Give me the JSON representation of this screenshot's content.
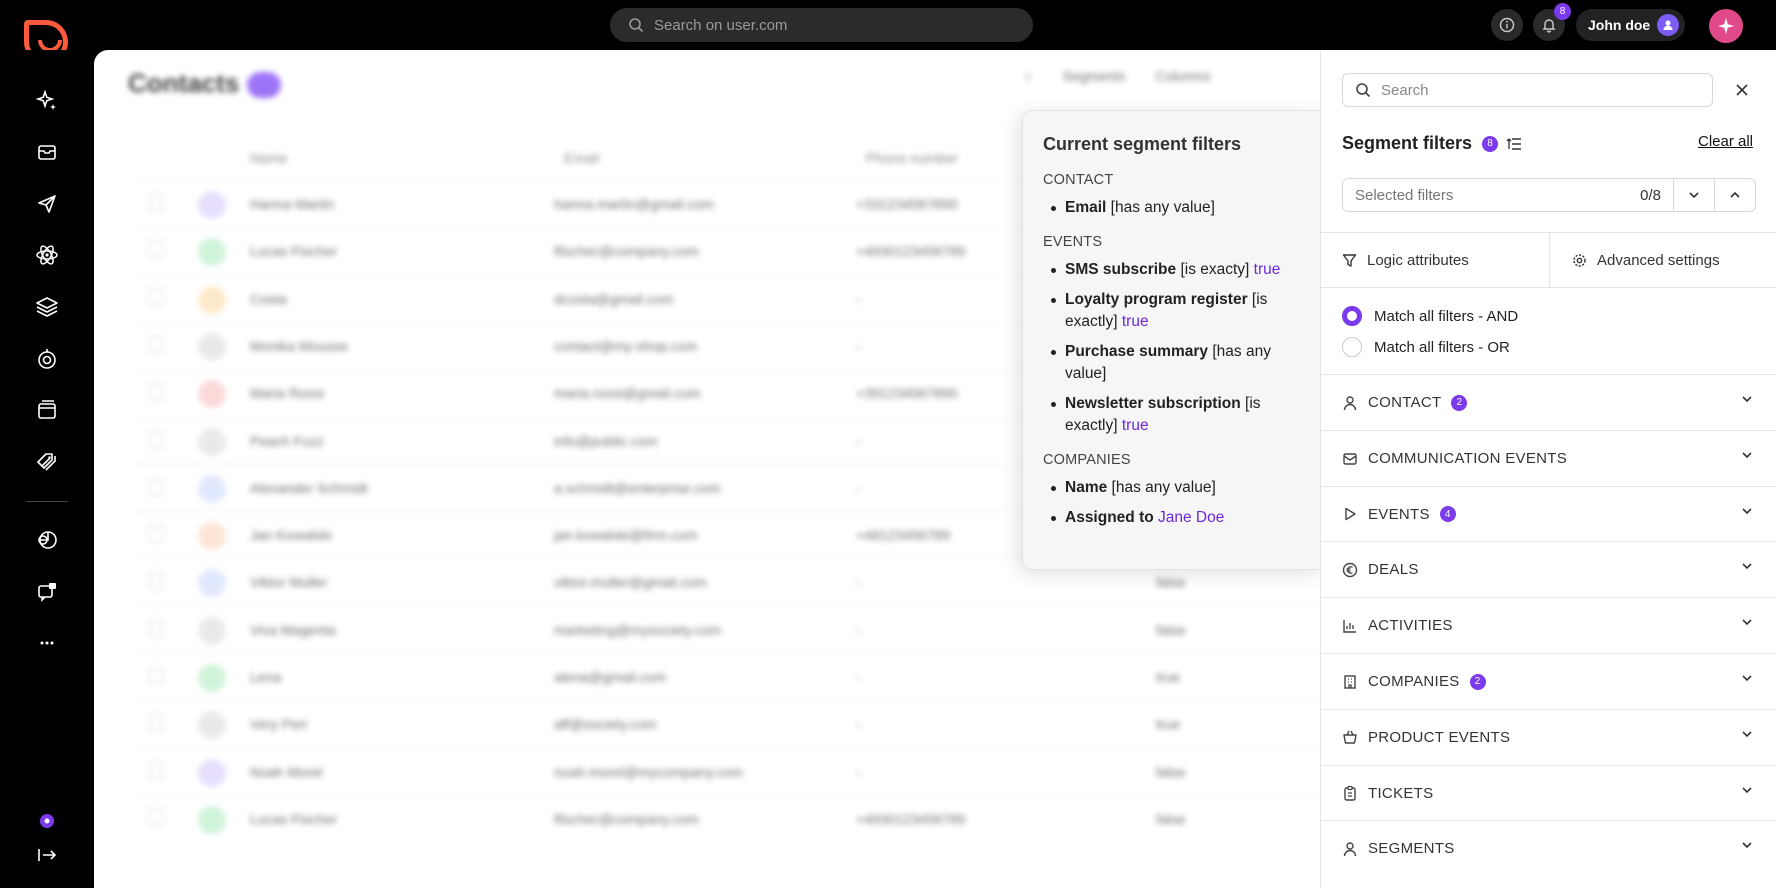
{
  "topbar": {
    "search_placeholder": "Search on user.com",
    "notification_count": "8",
    "user_name": "John doe"
  },
  "sidebar": {
    "icons": [
      "sparkles-icon",
      "inbox-icon",
      "send-icon",
      "atom-icon",
      "layers-icon",
      "analytics-icon",
      "browser-window-icon",
      "tags-icon",
      "pie-icon",
      "chat-icon",
      "more-icon"
    ]
  },
  "contacts": {
    "title": "Contacts",
    "toolbar": {
      "segments": "Segments",
      "columns": "Columns"
    },
    "columns": {
      "name": "Name",
      "email": "Email",
      "phone": "Phone number"
    },
    "rows": [
      {
        "initials": "HM",
        "name": "Hanna Martin",
        "email": "hanna.martin@gmail.com",
        "phone": "+331234567890",
        "bool": "",
        "color": "#e2d9fb"
      },
      {
        "initials": "LF",
        "name": "Lucas Fischer",
        "email": "lfischer@company.com",
        "phone": "+4930123456789",
        "bool": "",
        "color": "#c9f1d4"
      },
      {
        "initials": "C",
        "name": "Costa",
        "email": "dcosta@gmail.com",
        "phone": "-",
        "bool": "",
        "color": "#fde7c2"
      },
      {
        "initials": "",
        "name": "Monika Mousse",
        "email": "contact@my-shop.com",
        "phone": "-",
        "bool": "",
        "color": "#e6e6e6"
      },
      {
        "initials": "MR",
        "name": "Maria Rossi",
        "email": "maria.rossi@gmail.com",
        "phone": "+391234567890",
        "bool": "",
        "color": "#fbd3d3"
      },
      {
        "initials": "",
        "name": "Peach Fuzz",
        "email": "info@public.com",
        "phone": "-",
        "bool": "",
        "color": "#e6e6e6"
      },
      {
        "initials": "AS",
        "name": "Alexander Schmidt",
        "email": "a.schmidt@enterprise.com",
        "phone": "-",
        "bool": "",
        "color": "#dbe4fd"
      },
      {
        "initials": "JK",
        "name": "Jan Kowalski",
        "email": "jan.kowalski@firm.com",
        "phone": "+48123456789",
        "bool": "",
        "color": "#fde0cf"
      },
      {
        "initials": "VM",
        "name": "Viktor Muller",
        "email": "viktor.muller@gmail.com",
        "phone": "-",
        "bool": "false",
        "color": "#dbe4fd"
      },
      {
        "initials": "",
        "name": "Viva Magenta",
        "email": "marketing@mysociety.com",
        "phone": "-",
        "bool": "false",
        "color": "#e6e6e6"
      },
      {
        "initials": "L",
        "name": "Lena",
        "email": "alena@gmail.com",
        "phone": "-",
        "bool": "true",
        "color": "#c9f1d4"
      },
      {
        "initials": "",
        "name": "Very Peri",
        "email": "aff@society.com",
        "phone": "-",
        "bool": "true",
        "color": "#e6e6e6"
      },
      {
        "initials": "NM",
        "name": "Noah Morel",
        "email": "noah.morel@mycompany.com",
        "phone": "-",
        "bool": "false",
        "color": "#e2d9fb"
      },
      {
        "initials": "LF",
        "name": "Lucas Fischer",
        "email": "lfischer@company.com",
        "phone": "+4930123456789",
        "bool": "false",
        "color": "#c9f1d4"
      }
    ]
  },
  "popover": {
    "title": "Current segment filters",
    "sections": [
      {
        "heading": "CONTACT",
        "items": [
          {
            "name": "Email",
            "op": "[has any value]",
            "value": ""
          }
        ]
      },
      {
        "heading": "EVENTS",
        "items": [
          {
            "name": "SMS subscribe",
            "op": "[is exacty]",
            "value": "true"
          },
          {
            "name": "Loyalty program register",
            "op": "[is exactly]",
            "value": "true"
          },
          {
            "name": "Purchase summary",
            "op": "[has any value]",
            "value": ""
          },
          {
            "name": "Newsletter subscription",
            "op": "[is exactly]",
            "value": "true"
          }
        ]
      },
      {
        "heading": "COMPANIES",
        "items": [
          {
            "name": "Name",
            "op": "[has any value]",
            "value": ""
          },
          {
            "name": "Assigned to",
            "op": "",
            "value": "Jane Doe"
          }
        ]
      }
    ]
  },
  "panel": {
    "search_placeholder": "Search",
    "title": "Segment filters",
    "filter_count": "8",
    "clear_all": "Clear all",
    "selected_filters_label": "Selected filters",
    "selected_filters_count": "0/8",
    "tab_logic": "Logic attributes",
    "tab_advanced": "Advanced settings",
    "match_and": "Match all filters - AND",
    "match_or": "Match all filters - OR",
    "accent_color": "#7c3aed",
    "categories": [
      {
        "label": "CONTACT",
        "badge": "2",
        "icon": "user-icon"
      },
      {
        "label": "COMMUNICATION EVENTS",
        "badge": "",
        "icon": "mail-icon"
      },
      {
        "label": "EVENTS",
        "badge": "4",
        "icon": "play-icon"
      },
      {
        "label": "DEALS",
        "badge": "",
        "icon": "euro-icon"
      },
      {
        "label": "ACTIVITIES",
        "badge": "",
        "icon": "bar-chart-icon"
      },
      {
        "label": "COMPANIES",
        "badge": "2",
        "icon": "building-icon"
      },
      {
        "label": "PRODUCT EVENTS",
        "badge": "",
        "icon": "basket-icon"
      },
      {
        "label": "TICKETS",
        "badge": "",
        "icon": "clipboard-icon"
      },
      {
        "label": "SEGMENTS",
        "badge": "",
        "icon": "user-icon"
      }
    ]
  }
}
